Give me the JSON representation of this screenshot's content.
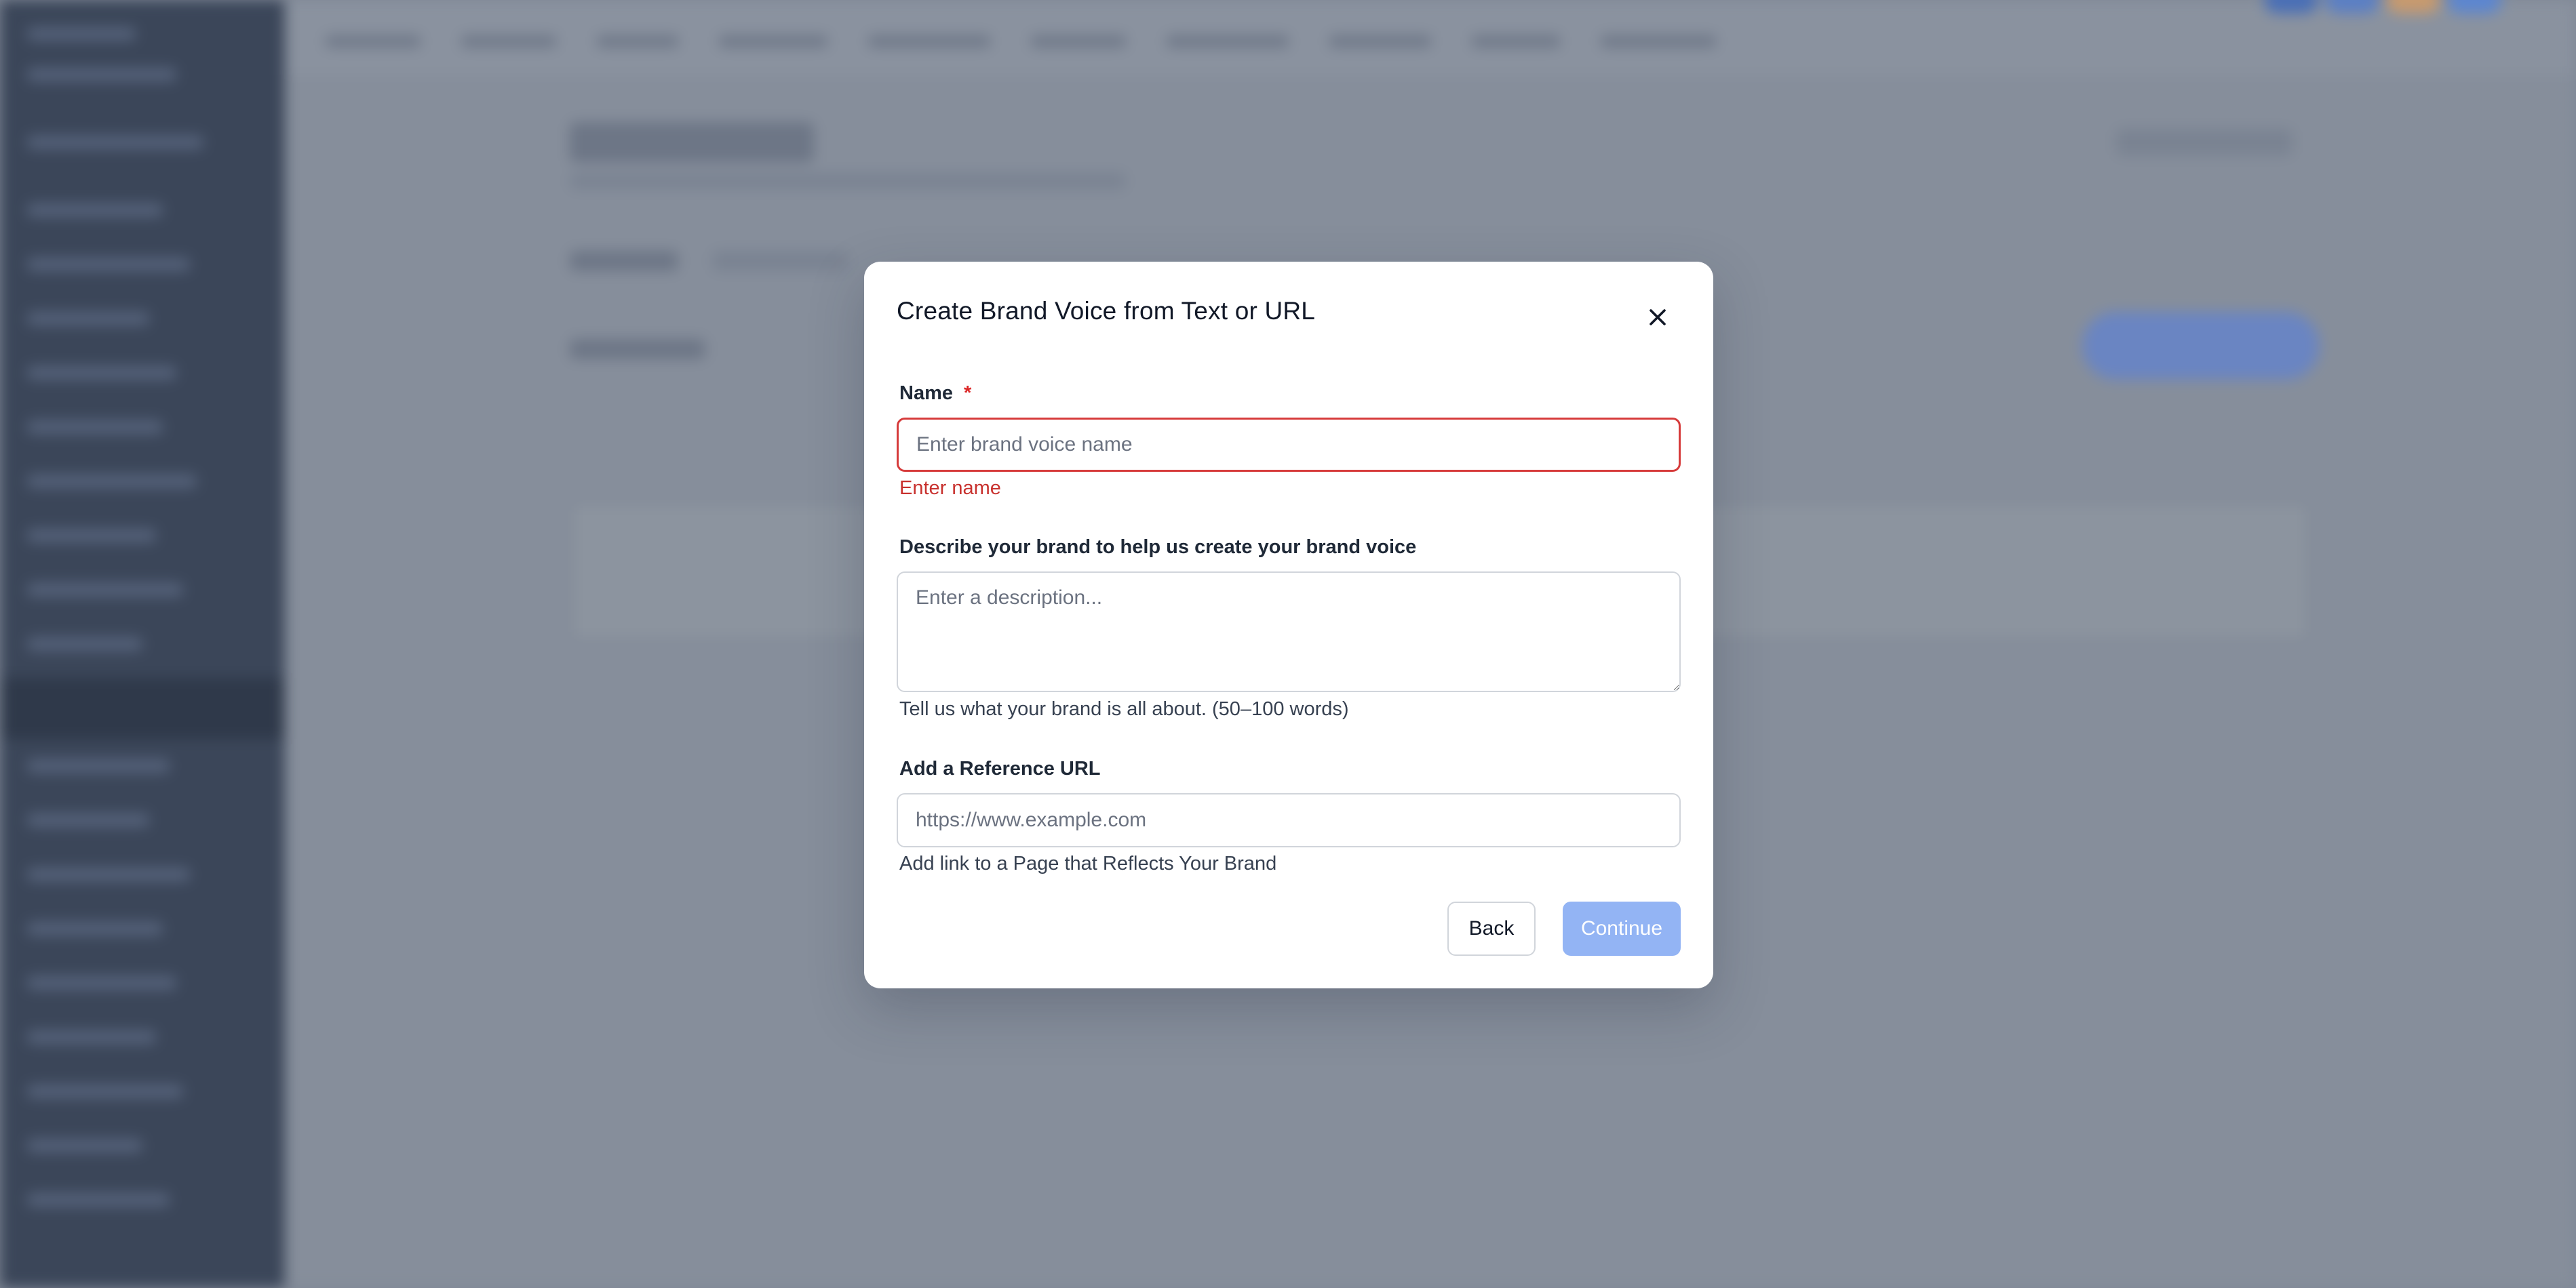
{
  "modal": {
    "title": "Create Brand Voice from Text or URL",
    "close_icon": "close-icon",
    "name_field": {
      "label": "Name",
      "required_marker": "*",
      "placeholder": "Enter brand voice name",
      "value": "",
      "error": "Enter name"
    },
    "description_field": {
      "label": "Describe your brand to help us create your brand voice",
      "placeholder": "Enter a description...",
      "value": "",
      "helper": "Tell us what your brand is all about. (50–100 words)"
    },
    "url_field": {
      "label": "Add a Reference URL",
      "placeholder": "https://www.example.com",
      "value": "",
      "helper": "Add link to a Page that Reflects Your Brand"
    },
    "buttons": {
      "back": "Back",
      "continue": "Continue"
    }
  },
  "colors": {
    "overlay": "#7f8896",
    "error": "#dc2626",
    "primary_disabled": "#93b4f4",
    "text": "#111827"
  }
}
